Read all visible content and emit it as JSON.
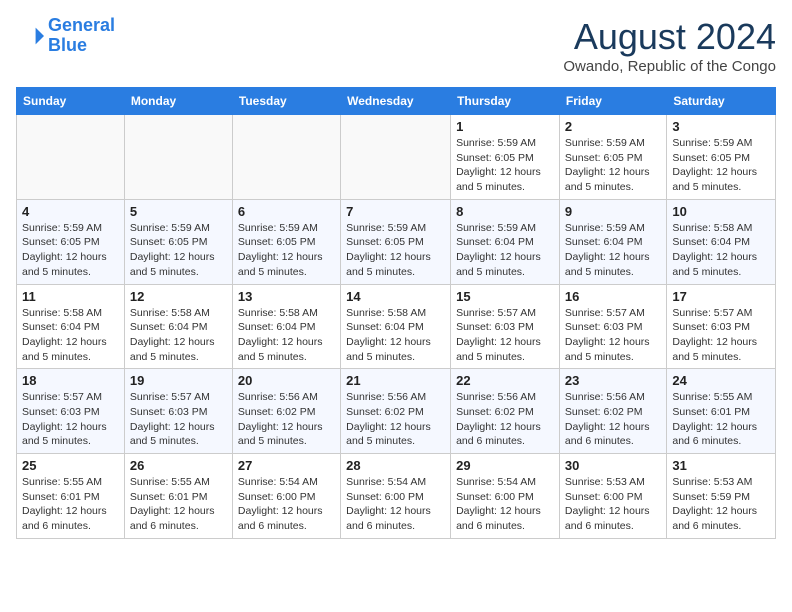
{
  "logo": {
    "line1": "General",
    "line2": "Blue"
  },
  "header": {
    "month_year": "August 2024",
    "location": "Owando, Republic of the Congo"
  },
  "days_of_week": [
    "Sunday",
    "Monday",
    "Tuesday",
    "Wednesday",
    "Thursday",
    "Friday",
    "Saturday"
  ],
  "weeks": [
    [
      {
        "day": "",
        "info": ""
      },
      {
        "day": "",
        "info": ""
      },
      {
        "day": "",
        "info": ""
      },
      {
        "day": "",
        "info": ""
      },
      {
        "day": "1",
        "info": "Sunrise: 5:59 AM\nSunset: 6:05 PM\nDaylight: 12 hours and 5 minutes."
      },
      {
        "day": "2",
        "info": "Sunrise: 5:59 AM\nSunset: 6:05 PM\nDaylight: 12 hours and 5 minutes."
      },
      {
        "day": "3",
        "info": "Sunrise: 5:59 AM\nSunset: 6:05 PM\nDaylight: 12 hours and 5 minutes."
      }
    ],
    [
      {
        "day": "4",
        "info": "Sunrise: 5:59 AM\nSunset: 6:05 PM\nDaylight: 12 hours and 5 minutes."
      },
      {
        "day": "5",
        "info": "Sunrise: 5:59 AM\nSunset: 6:05 PM\nDaylight: 12 hours and 5 minutes."
      },
      {
        "day": "6",
        "info": "Sunrise: 5:59 AM\nSunset: 6:05 PM\nDaylight: 12 hours and 5 minutes."
      },
      {
        "day": "7",
        "info": "Sunrise: 5:59 AM\nSunset: 6:05 PM\nDaylight: 12 hours and 5 minutes."
      },
      {
        "day": "8",
        "info": "Sunrise: 5:59 AM\nSunset: 6:04 PM\nDaylight: 12 hours and 5 minutes."
      },
      {
        "day": "9",
        "info": "Sunrise: 5:59 AM\nSunset: 6:04 PM\nDaylight: 12 hours and 5 minutes."
      },
      {
        "day": "10",
        "info": "Sunrise: 5:58 AM\nSunset: 6:04 PM\nDaylight: 12 hours and 5 minutes."
      }
    ],
    [
      {
        "day": "11",
        "info": "Sunrise: 5:58 AM\nSunset: 6:04 PM\nDaylight: 12 hours and 5 minutes."
      },
      {
        "day": "12",
        "info": "Sunrise: 5:58 AM\nSunset: 6:04 PM\nDaylight: 12 hours and 5 minutes."
      },
      {
        "day": "13",
        "info": "Sunrise: 5:58 AM\nSunset: 6:04 PM\nDaylight: 12 hours and 5 minutes."
      },
      {
        "day": "14",
        "info": "Sunrise: 5:58 AM\nSunset: 6:04 PM\nDaylight: 12 hours and 5 minutes."
      },
      {
        "day": "15",
        "info": "Sunrise: 5:57 AM\nSunset: 6:03 PM\nDaylight: 12 hours and 5 minutes."
      },
      {
        "day": "16",
        "info": "Sunrise: 5:57 AM\nSunset: 6:03 PM\nDaylight: 12 hours and 5 minutes."
      },
      {
        "day": "17",
        "info": "Sunrise: 5:57 AM\nSunset: 6:03 PM\nDaylight: 12 hours and 5 minutes."
      }
    ],
    [
      {
        "day": "18",
        "info": "Sunrise: 5:57 AM\nSunset: 6:03 PM\nDaylight: 12 hours and 5 minutes."
      },
      {
        "day": "19",
        "info": "Sunrise: 5:57 AM\nSunset: 6:03 PM\nDaylight: 12 hours and 5 minutes."
      },
      {
        "day": "20",
        "info": "Sunrise: 5:56 AM\nSunset: 6:02 PM\nDaylight: 12 hours and 5 minutes."
      },
      {
        "day": "21",
        "info": "Sunrise: 5:56 AM\nSunset: 6:02 PM\nDaylight: 12 hours and 5 minutes."
      },
      {
        "day": "22",
        "info": "Sunrise: 5:56 AM\nSunset: 6:02 PM\nDaylight: 12 hours and 6 minutes."
      },
      {
        "day": "23",
        "info": "Sunrise: 5:56 AM\nSunset: 6:02 PM\nDaylight: 12 hours and 6 minutes."
      },
      {
        "day": "24",
        "info": "Sunrise: 5:55 AM\nSunset: 6:01 PM\nDaylight: 12 hours and 6 minutes."
      }
    ],
    [
      {
        "day": "25",
        "info": "Sunrise: 5:55 AM\nSunset: 6:01 PM\nDaylight: 12 hours and 6 minutes."
      },
      {
        "day": "26",
        "info": "Sunrise: 5:55 AM\nSunset: 6:01 PM\nDaylight: 12 hours and 6 minutes."
      },
      {
        "day": "27",
        "info": "Sunrise: 5:54 AM\nSunset: 6:00 PM\nDaylight: 12 hours and 6 minutes."
      },
      {
        "day": "28",
        "info": "Sunrise: 5:54 AM\nSunset: 6:00 PM\nDaylight: 12 hours and 6 minutes."
      },
      {
        "day": "29",
        "info": "Sunrise: 5:54 AM\nSunset: 6:00 PM\nDaylight: 12 hours and 6 minutes."
      },
      {
        "day": "30",
        "info": "Sunrise: 5:53 AM\nSunset: 6:00 PM\nDaylight: 12 hours and 6 minutes."
      },
      {
        "day": "31",
        "info": "Sunrise: 5:53 AM\nSunset: 5:59 PM\nDaylight: 12 hours and 6 minutes."
      }
    ]
  ]
}
